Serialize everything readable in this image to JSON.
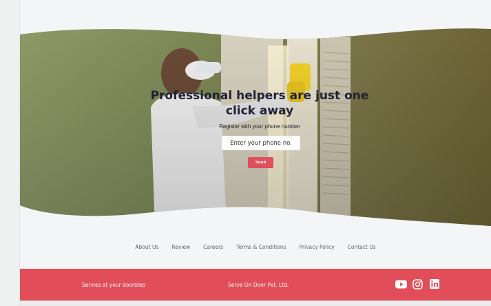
{
  "hero": {
    "headline": "Professional helpers are just one click away",
    "subline": "Register with your phone number",
    "phone_placeholder": "Enter your phone no.",
    "send_label": "Send"
  },
  "nav": {
    "items": [
      {
        "label": "About Us"
      },
      {
        "label": "Review"
      },
      {
        "label": "Careers"
      },
      {
        "label": "Terms & Conditions"
      },
      {
        "label": "Privacy Policy"
      },
      {
        "label": "Contact Us"
      }
    ]
  },
  "footer": {
    "tagline": "Servies at your doorstep",
    "company": "Serve On Door Pvt. Ltd.",
    "social": [
      "youtube-icon",
      "instagram-icon",
      "linkedin-icon"
    ]
  },
  "colors": {
    "accent": "#e14e5a",
    "background": "#f3f5f7",
    "headline": "#1f2236"
  }
}
